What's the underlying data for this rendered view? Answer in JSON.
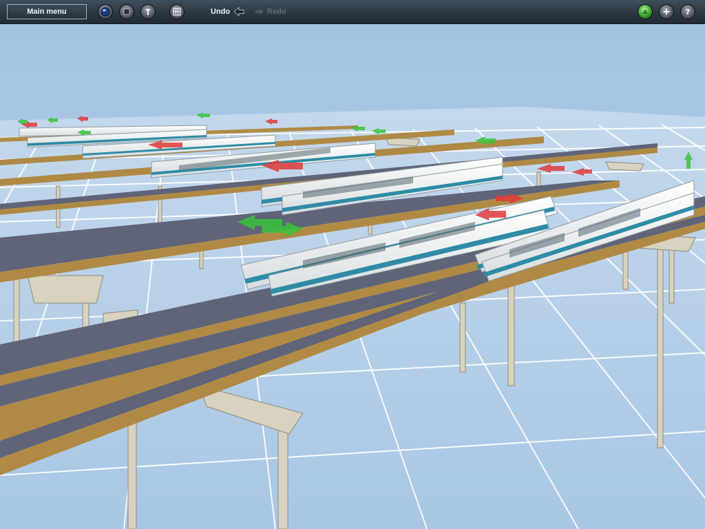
{
  "toolbar": {
    "main_menu_label": "Main menu",
    "undo_label": "Undo",
    "redo_label": "Redo",
    "buttons_left": [
      {
        "name": "camera-mode-button",
        "icon": "globe-icon"
      },
      {
        "name": "stop-button",
        "icon": "stop-icon"
      },
      {
        "name": "tools-button",
        "icon": "wrench-icon"
      },
      {
        "name": "layout-button",
        "icon": "grid-icon"
      }
    ],
    "buttons_right": [
      {
        "name": "status-button",
        "icon": "green-light-icon"
      },
      {
        "name": "add-button",
        "icon": "plus-icon"
      },
      {
        "name": "help-button",
        "icon": "question-icon"
      }
    ]
  },
  "scene": {
    "description_colors": {
      "sky_top": "#9ec0e0",
      "ground": "#bcd4ea",
      "grid_line": "#ffffff",
      "track_wood": "#b08a45",
      "rail": "#5f6478",
      "monorail_body": "#f4f6f6",
      "monorail_stripe": "#2f8ca6",
      "marker_green": "#39c43a",
      "marker_red": "#e03a3a"
    }
  }
}
